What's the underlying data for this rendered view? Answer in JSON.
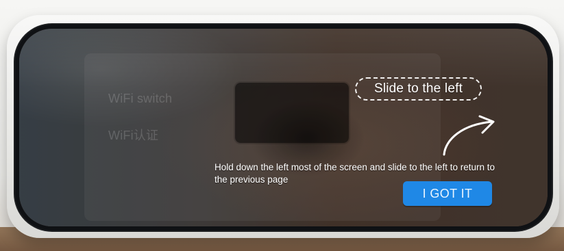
{
  "screen": {
    "background_menu": {
      "items": [
        {
          "label": "WiFi switch"
        },
        {
          "label": "WiFi认证"
        }
      ]
    },
    "hint": {
      "title": "Slide to the left",
      "instruction": "Hold down the left most of the screen and slide to the left to return to the previous page",
      "button_label": "I GOT IT",
      "icon": "curved-arrow-right-icon",
      "accent_color": "#1f88e6"
    }
  }
}
